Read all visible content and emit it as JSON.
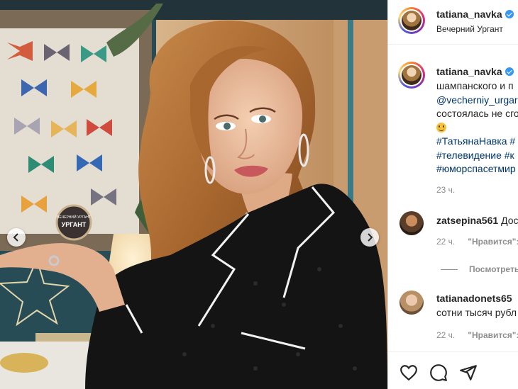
{
  "post": {
    "username": "tatiana_navka",
    "location": "Вечерний Ургант",
    "caption_lines": [
      "шампанского и п",
      "@vecherniy_urgar",
      "состоялась не сго"
    ],
    "hashtag_lines": [
      "#ТатьянаНавка #",
      "#телевидение #к",
      "#юморспасетмир"
    ],
    "time": "23 ч."
  },
  "comments": [
    {
      "username": "zatsepina561",
      "text": "Дос",
      "time": "22 ч.",
      "like_label": "\"Нравится\": "
    },
    {
      "username": "tatianadonets65",
      "text": "сотни тысяч рубл",
      "time": "22 ч.",
      "like_label": "\"Нравится\": "
    }
  ],
  "view_replies_label": "Посмотреть",
  "photo": {
    "sign_label": "ВЕЧЕРНИЙ УРГАНТ",
    "sign_short": "УРГАНТ"
  },
  "icons": {
    "verified": "verified-badge-icon",
    "like": "heart-icon",
    "comment": "comment-icon",
    "share": "paper-plane-icon",
    "prev": "chevron-left-icon",
    "next": "chevron-right-icon"
  },
  "colors": {
    "link": "#00376b",
    "verified": "#3897f0",
    "muted": "#8e8e8e"
  }
}
